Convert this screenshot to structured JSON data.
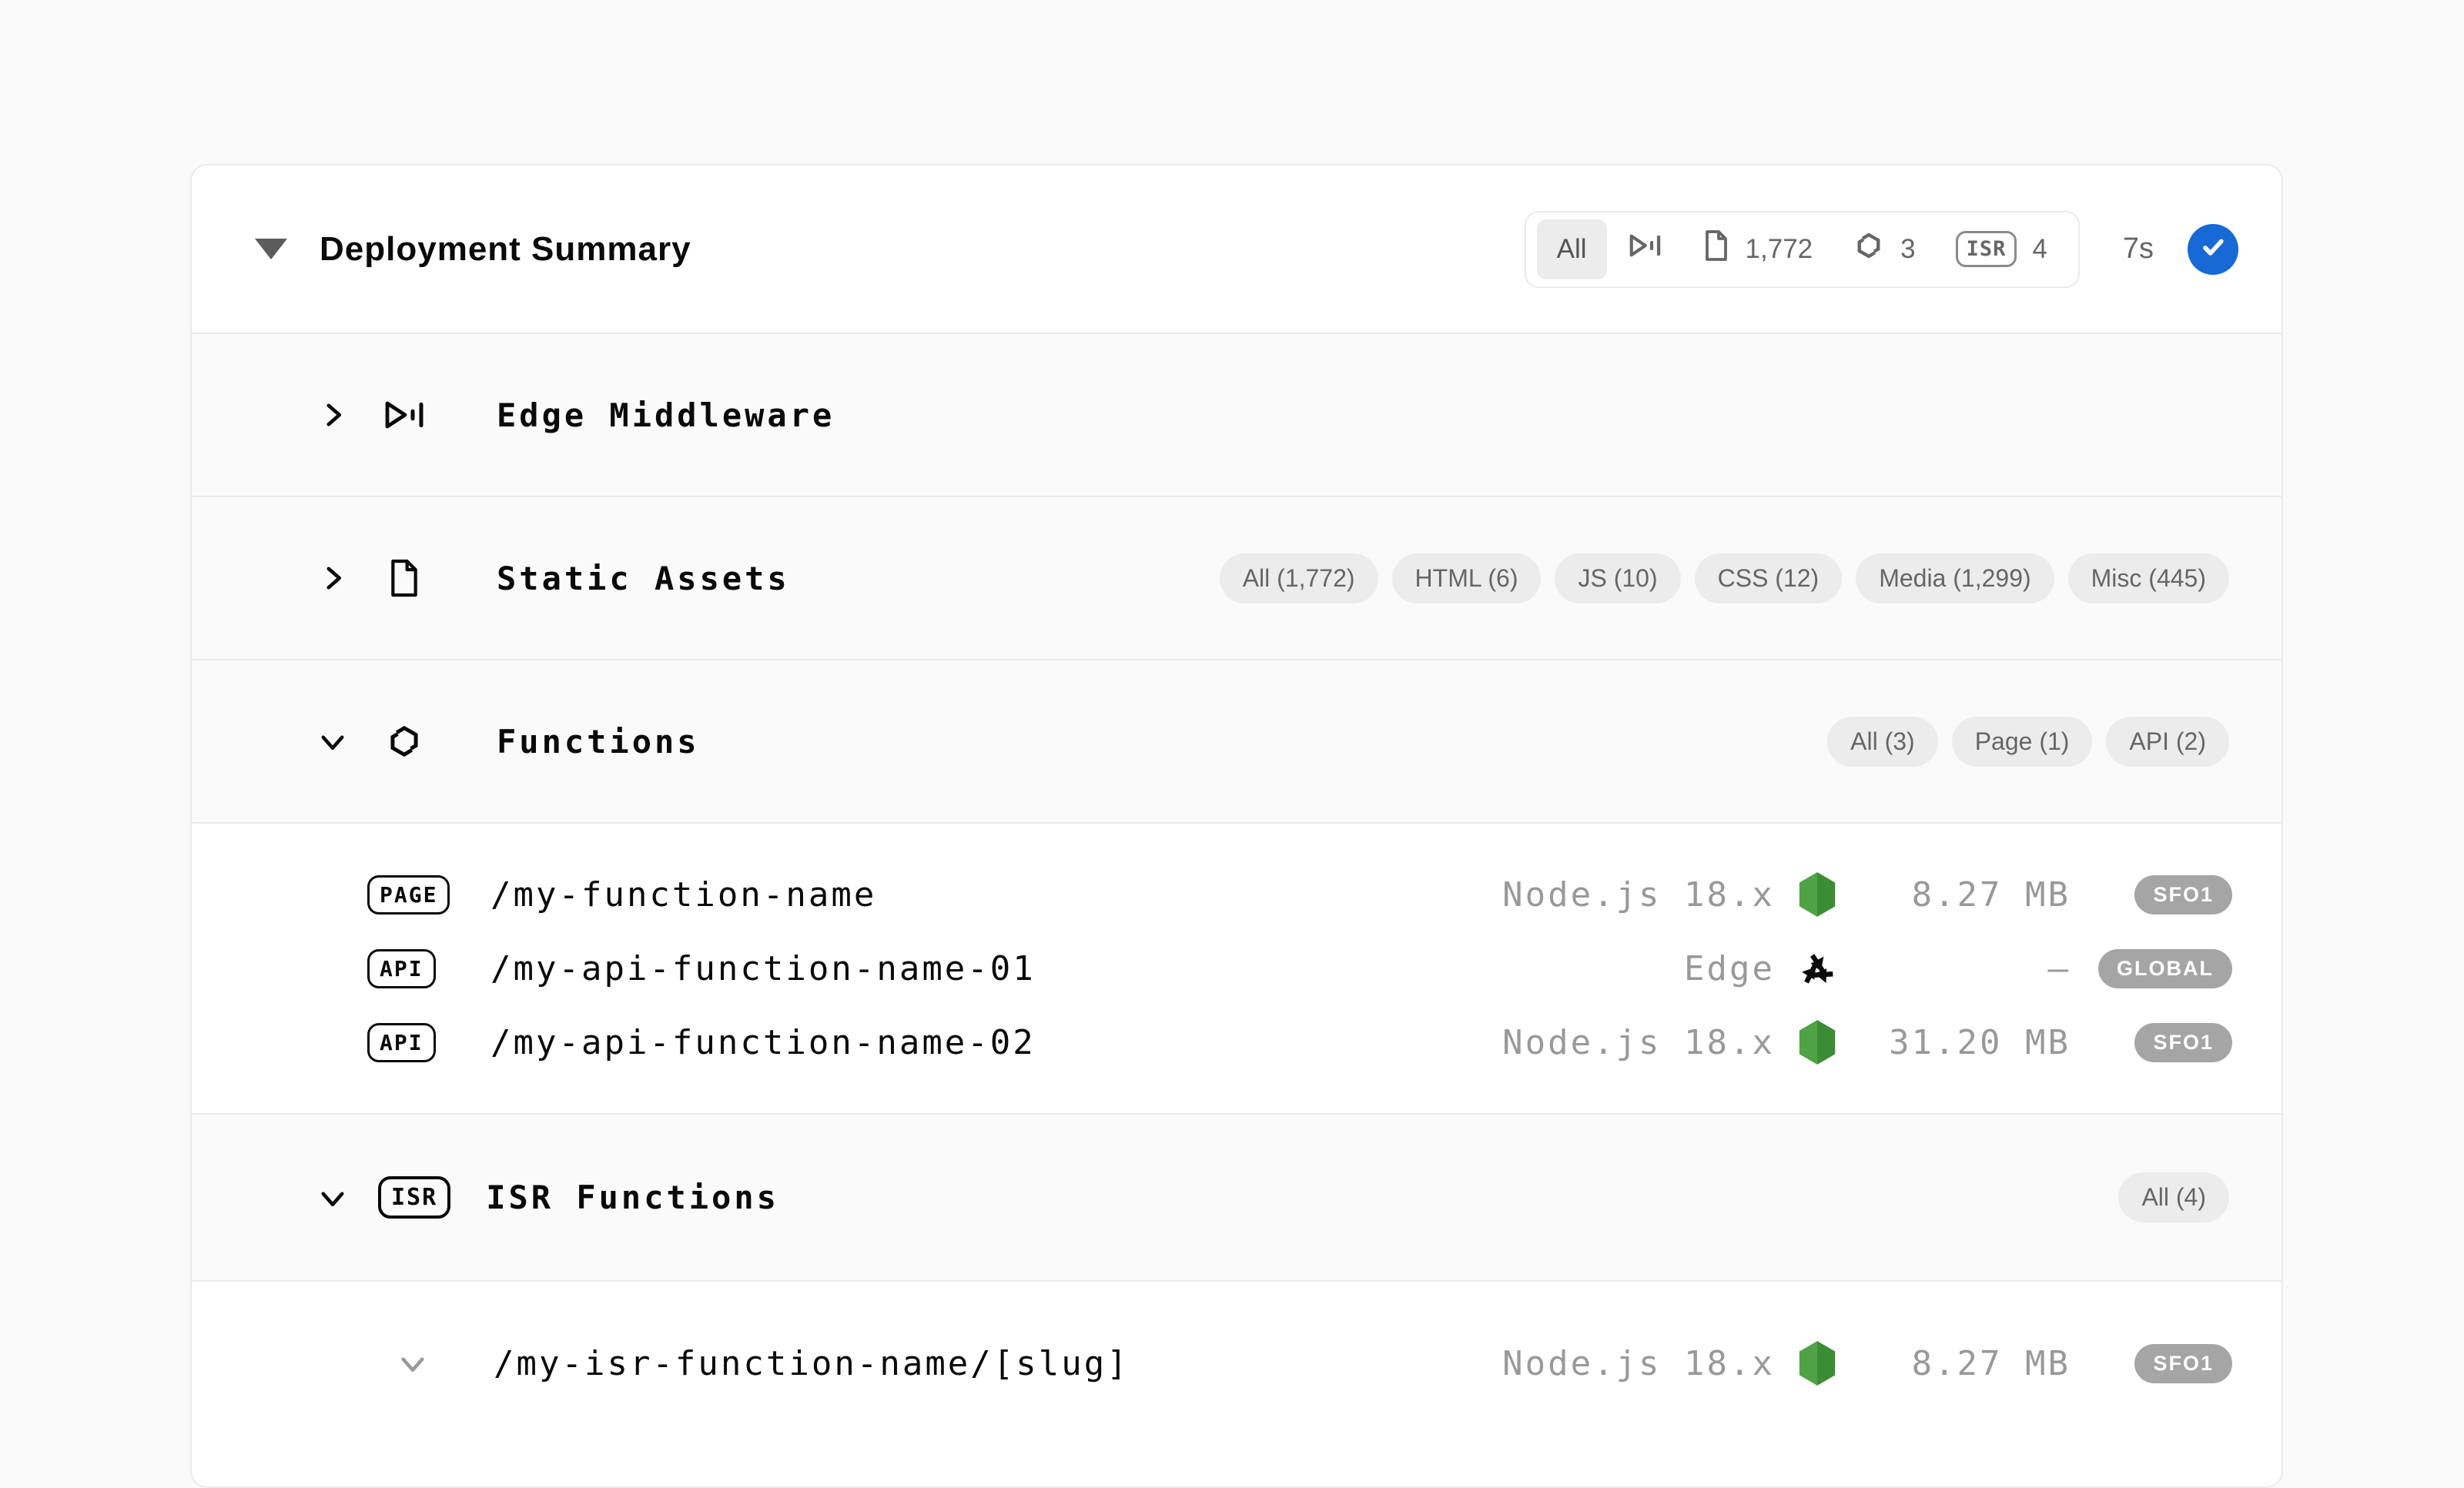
{
  "header": {
    "title": "Deployment Summary",
    "duration": "7s",
    "filter": {
      "all": "All",
      "assets_count": "1,772",
      "functions_count": "3",
      "isr_label": "ISR",
      "isr_count": "4"
    }
  },
  "sections": {
    "edge_middleware": {
      "title": "Edge Middleware"
    },
    "static_assets": {
      "title": "Static Assets",
      "pills": [
        "All (1,772)",
        "HTML (6)",
        "JS (10)",
        "CSS (12)",
        "Media (1,299)",
        "Misc (445)"
      ]
    },
    "functions": {
      "title": "Functions",
      "pills": [
        "All (3)",
        "Page (1)",
        "API (2)"
      ],
      "rows": [
        {
          "badge": "PAGE",
          "path": "/my-function-name",
          "runtime": "Node.js 18.x",
          "size": "8.27 MB",
          "region": "SFO1"
        },
        {
          "badge": "API",
          "path": "/my-api-function-name-01",
          "runtime": "Edge",
          "size": "—",
          "region": "GLOBAL"
        },
        {
          "badge": "API",
          "path": "/my-api-function-name-02",
          "runtime": "Node.js 18.x",
          "size": "31.20 MB",
          "region": "SFO1"
        }
      ]
    },
    "isr_functions": {
      "title": "ISR Functions",
      "badge": "ISR",
      "pills": [
        "All (4)"
      ],
      "rows": [
        {
          "path": "/my-isr-function-name/[slug]",
          "runtime": "Node.js 18.x",
          "size": "8.27 MB",
          "region": "SFO1"
        }
      ]
    }
  },
  "icons": {
    "status": "check-icon",
    "collapse_open": "chevron-down-icon",
    "collapse_closed": "chevron-right-icon",
    "header_caret": "caret-down-icon",
    "edge_middleware": "play-pause-icon",
    "static_assets": "file-icon",
    "functions": "hexagon-s-icon",
    "node_runtime": "node-hexagon-icon",
    "edge_runtime": "edge-triangle-icon"
  },
  "colors": {
    "accent_blue": "#1769d6",
    "node_green": "#4fa344",
    "node_green_dark": "#3c8c36",
    "region_badge_gray": "#a5a5a5",
    "pill_bg": "#ececec",
    "pill_text": "#666666",
    "runtime_text": "#999999",
    "section_bg": "#fafafa",
    "border": "#ebebeb"
  }
}
